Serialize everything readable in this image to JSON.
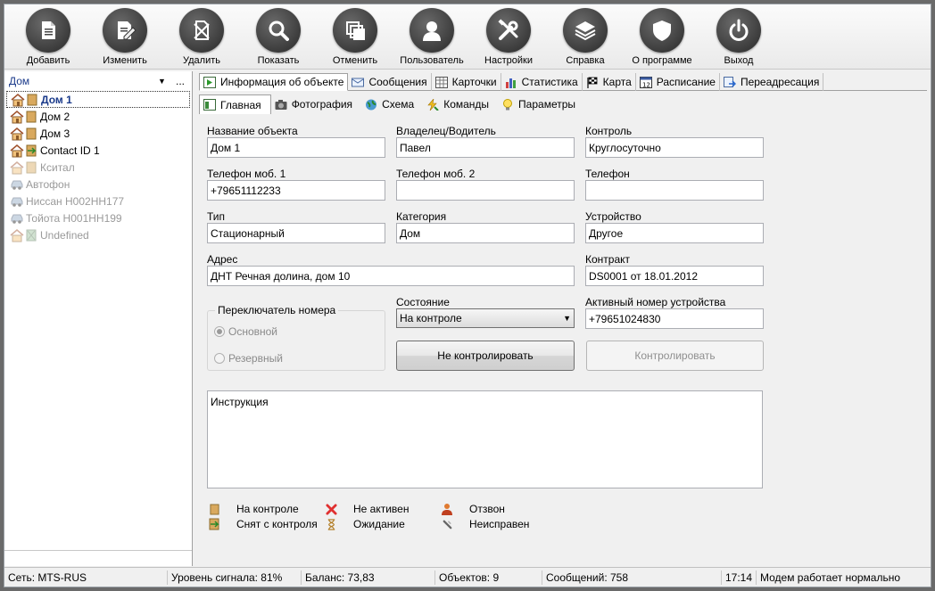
{
  "toolbar": {
    "buttons": [
      {
        "label": "Добавить",
        "icon": "document-icon"
      },
      {
        "label": "Изменить",
        "icon": "edit-icon"
      },
      {
        "label": "Удалить",
        "icon": "delete-icon"
      },
      {
        "label": "Показать",
        "icon": "search-icon"
      },
      {
        "label": "Отменить",
        "icon": "copy-icon"
      },
      {
        "label": "Пользователь",
        "icon": "user-icon"
      },
      {
        "label": "Настройки",
        "icon": "tools-icon"
      },
      {
        "label": "Справка",
        "icon": "layers-icon"
      },
      {
        "label": "О программе",
        "icon": "shield-icon"
      },
      {
        "label": "Выход",
        "icon": "power-icon"
      }
    ]
  },
  "left": {
    "combo_value": "Дом",
    "combo_more": "...",
    "items": [
      {
        "label": "Дом 1",
        "kind": "house",
        "state": "selected"
      },
      {
        "label": "Дом 2",
        "kind": "house",
        "state": "normal"
      },
      {
        "label": "Дом 3",
        "kind": "house",
        "state": "normal"
      },
      {
        "label": "Contact ID 1",
        "kind": "house-green",
        "state": "normal"
      },
      {
        "label": "Кситал",
        "kind": "house-dim",
        "state": "dim"
      },
      {
        "label": "Автофон",
        "kind": "car",
        "state": "dim"
      },
      {
        "label": "Ниссан Н002НН177",
        "kind": "car",
        "state": "dim"
      },
      {
        "label": "Тойота Н001НН199",
        "kind": "car",
        "state": "dim"
      },
      {
        "label": "Undefined",
        "kind": "house-dim",
        "state": "dim"
      }
    ]
  },
  "tabs": [
    {
      "label": "Информация об объекте",
      "active": true
    },
    {
      "label": "Сообщения"
    },
    {
      "label": "Карточки"
    },
    {
      "label": "Статистика"
    },
    {
      "label": "Карта"
    },
    {
      "label": "Расписание"
    },
    {
      "label": "Переадресация"
    }
  ],
  "subtabs": [
    {
      "label": "Главная",
      "active": true
    },
    {
      "label": "Фотография"
    },
    {
      "label": "Схема"
    },
    {
      "label": "Команды"
    },
    {
      "label": "Параметры"
    }
  ],
  "form": {
    "object_name_label": "Название объекта",
    "object_name_value": "Дом 1",
    "owner_label": "Владелец/Водитель",
    "owner_value": "Павел",
    "control_label": "Контроль",
    "control_value": "Круглосуточно",
    "mobile1_label": "Телефон моб. 1",
    "mobile1_value": "+79651112233",
    "mobile2_label": "Телефон моб. 2",
    "mobile2_value": "",
    "phone_label": "Телефон",
    "phone_value": "",
    "type_label": "Тип",
    "type_value": "Стационарный",
    "category_label": "Категория",
    "category_value": "Дом",
    "device_label": "Устройство",
    "device_value": "Другое",
    "address_label": "Адрес",
    "address_value": "ДНТ Речная долина, дом 10",
    "contract_label": "Контракт",
    "contract_value": "DS0001 от 18.01.2012",
    "switch_group_title": "Переключатель номера",
    "radio_main": "Основной",
    "radio_reserve": "Резервный",
    "state_label": "Состояние",
    "state_value": "На контроле",
    "active_number_label": "Активный номер устройства",
    "active_number_value": "+79651024830",
    "btn_uncontrol": "Не контролировать",
    "btn_control": "Контролировать",
    "instruction_label": "Инструкция"
  },
  "legend": [
    {
      "label": "На контроле",
      "icon": "door-icon"
    },
    {
      "label": "Снят с контроля",
      "icon": "door-open-icon"
    },
    {
      "label": "Не активен",
      "icon": "red-x-icon"
    },
    {
      "label": "Ожидание",
      "icon": "hourglass-icon"
    },
    {
      "label": "Отзвон",
      "icon": "person-icon"
    },
    {
      "label": "Неисправен",
      "icon": "wrench-icon"
    }
  ],
  "status": {
    "network": "Сеть: MTS-RUS",
    "signal": "Уровень сигнала: 81%",
    "balance": "Баланс: 73,83",
    "objects": "Объектов: 9",
    "messages": "Сообщений: 758",
    "time": "17:14",
    "modem": "Модем работает нормально"
  },
  "colors": {
    "accent": "#1a3a8a",
    "toolbar_circle": "#3c3c3c"
  }
}
